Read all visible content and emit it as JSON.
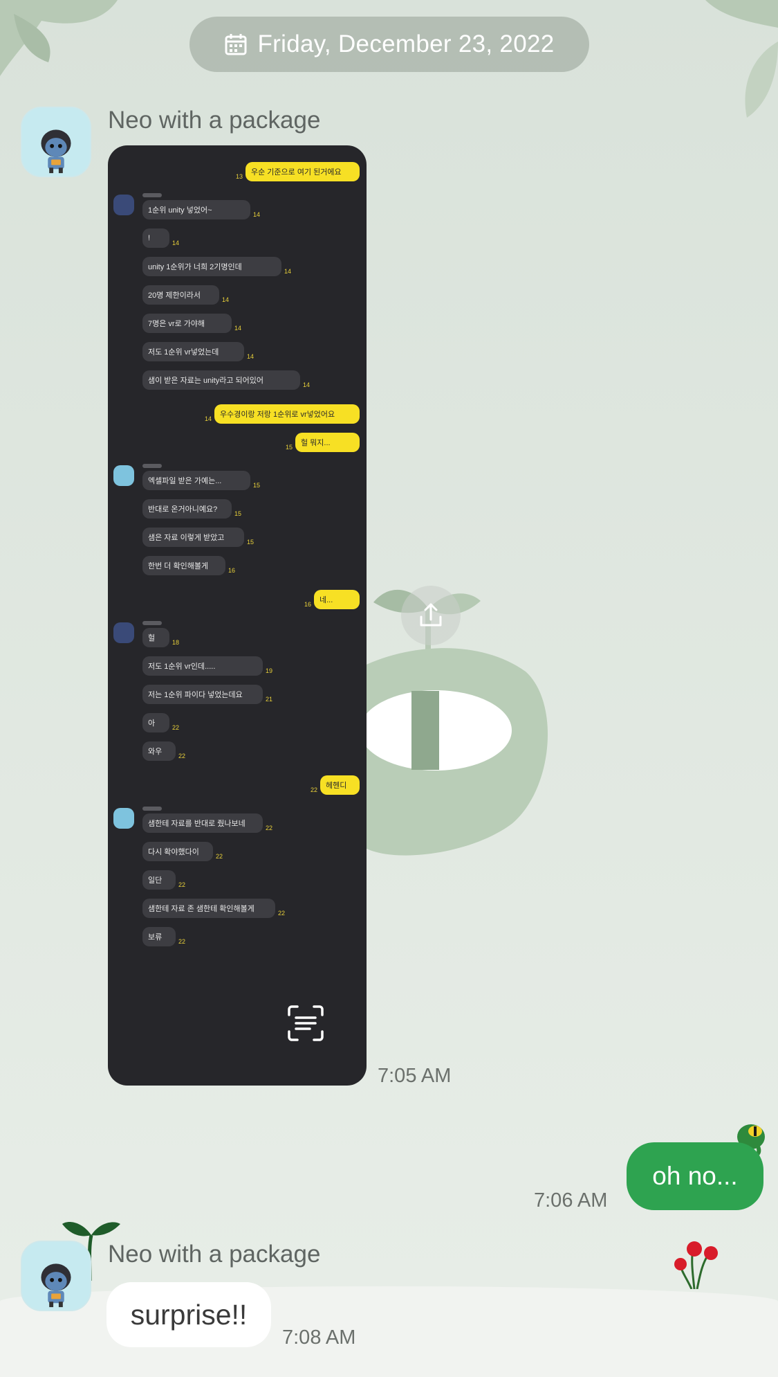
{
  "date_header": {
    "icon": "calendar-icon",
    "text": "Friday, December 23, 2022"
  },
  "messages": [
    {
      "sender": "Neo with a package",
      "type": "image",
      "time": "7:05 AM"
    },
    {
      "direction": "outgoing",
      "text": "oh no...",
      "time": "7:06 AM"
    },
    {
      "sender": "Neo with a package",
      "text": "surprise!!",
      "time": "7:08 AM"
    }
  ],
  "screenshot_content": {
    "rows": [
      {
        "side": "right",
        "text": "우순 기준으로 여기 된거에요",
        "num": "13"
      },
      {
        "side": "left",
        "text": "1순위 unity 넣었어~",
        "num": "14"
      },
      {
        "side": "left",
        "text": "!",
        "num": "14"
      },
      {
        "side": "left",
        "text": "unity 1순위가 너희 2기명인데",
        "num": "14"
      },
      {
        "side": "left",
        "text": "20명 제한이라서",
        "num": "14"
      },
      {
        "side": "left",
        "text": "7명은 vr로 가야해",
        "num": "14"
      },
      {
        "side": "left",
        "text": "저도 1순위 vr넣었는데",
        "num": "14"
      },
      {
        "side": "left",
        "text": "샘이 받은 자료는 unity라고 되어있어",
        "num": "14"
      },
      {
        "side": "right",
        "text": "우수경이랑 저랑 1순위로 vr넣었어요",
        "num": "14"
      },
      {
        "side": "right",
        "text": "헐 뭐지...",
        "num": "15"
      },
      {
        "side": "left",
        "text": "엑셀파일 받은 가예는...",
        "num": "15"
      },
      {
        "side": "left",
        "text": "반대로 온거아니예요?",
        "num": "15"
      },
      {
        "side": "left",
        "text": "샘은 자료 이렇게 받았고",
        "num": "15"
      },
      {
        "side": "left",
        "text": "한번 더 확인해볼게",
        "num": "16"
      },
      {
        "side": "right",
        "text": "네...",
        "num": "16"
      },
      {
        "side": "left",
        "text": "헐",
        "num": "18"
      },
      {
        "side": "left",
        "text": "저도 1순위 vr인데.....",
        "num": "19"
      },
      {
        "side": "left",
        "text": "저는 1순위 파이다 넣었는데요",
        "num": "21"
      },
      {
        "side": "left",
        "text": "아",
        "num": "22"
      },
      {
        "side": "left",
        "text": "와우",
        "num": "22"
      },
      {
        "side": "right",
        "text": "헤헨디",
        "num": "22"
      },
      {
        "side": "left",
        "text": "샘한테 자료를 반대로 줬나보네",
        "num": "22"
      },
      {
        "side": "left",
        "text": "다시 확야했다이",
        "num": "22"
      },
      {
        "side": "left",
        "text": "일단",
        "num": "22"
      },
      {
        "side": "left",
        "text": "샘한테 자료 존 샘한테 확인해볼게",
        "num": "22"
      },
      {
        "side": "left",
        "text": "보류",
        "num": "22"
      }
    ]
  },
  "icons": {
    "share": "share-icon",
    "scan_text": "scan-text-icon",
    "avatar": "neo-avatar-icon"
  },
  "colors": {
    "outgoing_bubble": "#2ea350",
    "incoming_bubble": "#ffffff",
    "background": "#dde5dd",
    "kakao_yellow": "#f7e024"
  }
}
